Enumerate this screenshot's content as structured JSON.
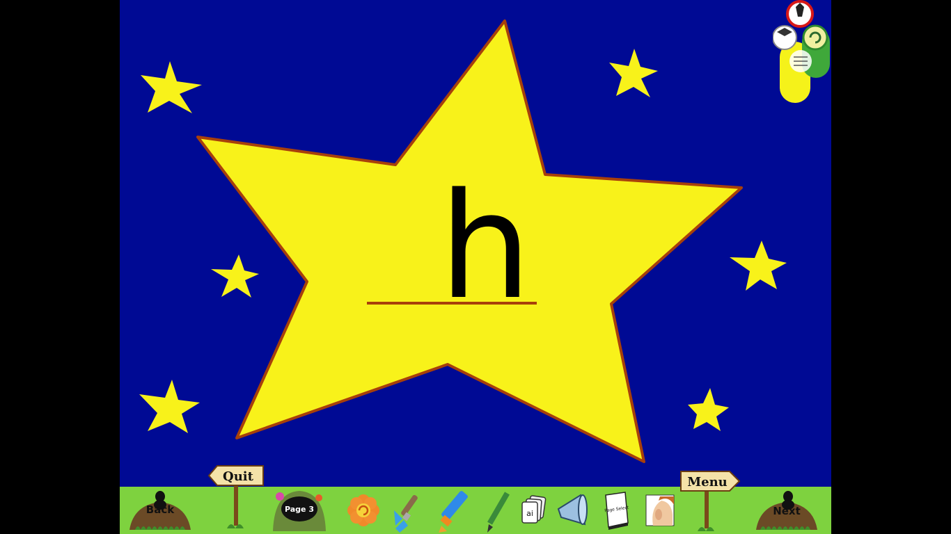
{
  "letter": "h",
  "toolbar": {
    "back_label": "Back",
    "quit_label": "Quit",
    "page_label": "Page 3",
    "menu_label": "Menu",
    "next_label": "Next",
    "flashcard_label": "ai",
    "page_select_label": "Page Select"
  },
  "icons": [
    "back-icon",
    "quit-sign-icon",
    "page-nav-icon",
    "flower-reset-icon",
    "paintbrush-icon",
    "crayon-icon",
    "pencil-icon",
    "flashcards-icon",
    "megaphone-icon",
    "page-select-icon",
    "listen-face-icon",
    "menu-sign-icon",
    "next-icon"
  ],
  "colors": {
    "background": "#000a94",
    "star": "#f8f21a",
    "star_outline": "#a8400a",
    "grass": "#7ed23f",
    "frame": "#000000"
  }
}
